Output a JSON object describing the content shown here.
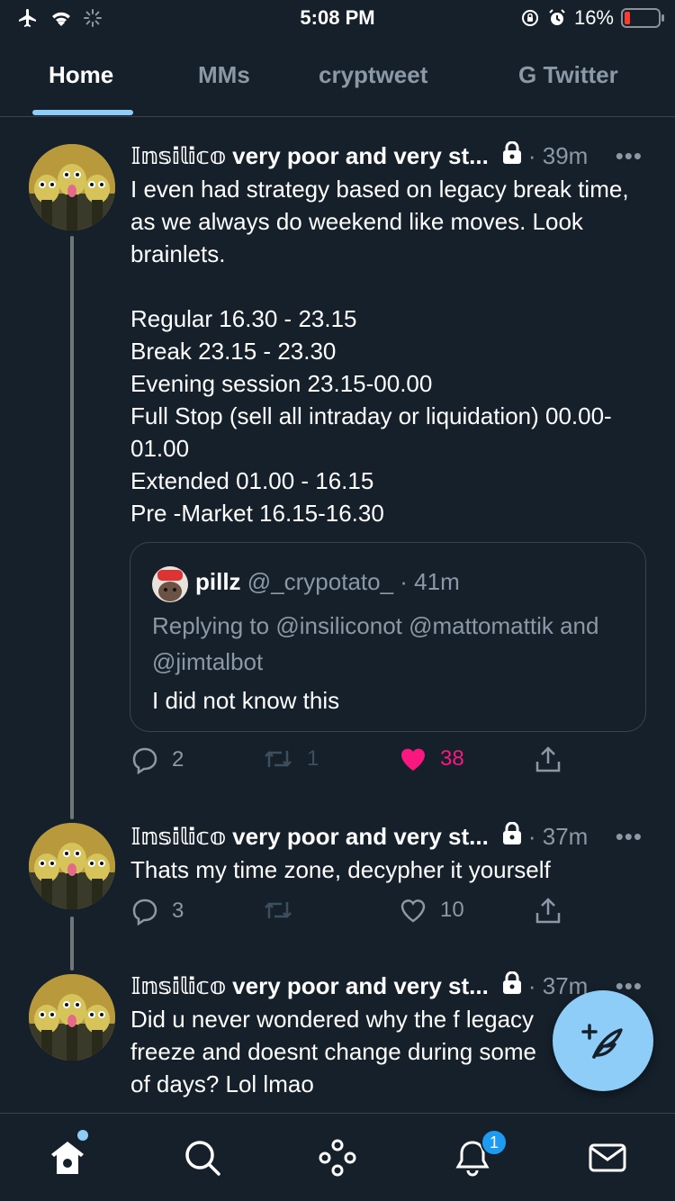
{
  "status_bar": {
    "time": "5:08 PM",
    "battery_text": "16%",
    "battery_level": 0.16,
    "battery_color": "#ff3b30"
  },
  "tabs": [
    {
      "label": "Home",
      "active": true
    },
    {
      "label": "MMs",
      "active": false
    },
    {
      "label": "cryptweet",
      "active": false
    },
    {
      "label": "G Twitter",
      "active": false
    }
  ],
  "tweets": [
    {
      "author": "𝕀𝕟𝕤𝕚𝕝𝕚𝕔𝕠 very poor and very st...",
      "time": "· 39m",
      "text": "I even had strategy based on legacy break time, as we always do weekend like moves. Look brainlets.\n\nRegular 16.30 - 23.15\nBreak 23.15 - 23.30\nEvening session 23.15-00.00\nFull Stop (sell all intraday or liquidation) 00.00-01.00\nExtended 01.00 - 16.15\nPre -Market 16.15-16.30",
      "quote": {
        "name": "pillz",
        "handle": "@_crypotato_",
        "time": "· 41m",
        "reply_prefix": "Replying to ",
        "reply_to": "@insiliconot @mattomattik and @jimtalbot",
        "text": "I did not know this"
      },
      "replies": "2",
      "retweets": "1",
      "likes": "38",
      "liked": true
    },
    {
      "author": "𝕀𝕟𝕤𝕚𝕝𝕚𝕔𝕠 very poor and very st...",
      "time": "· 37m",
      "text": "Thats my time zone, decypher it yourself",
      "replies": "3",
      "retweets": "",
      "likes": "10",
      "liked": false
    },
    {
      "author": "𝕀𝕟𝕤𝕚𝕝𝕚𝕔𝕠 very poor and very st...",
      "time": "· 37m",
      "text": "Did u never wondered why the f legacy\nfreeze and doesnt change during some\nof days? Lol lmao"
    }
  ],
  "notifications_badge": "1",
  "colors": {
    "background": "#15202b",
    "accent": "#8ecdf8",
    "secondary_text": "#8b98a5",
    "like": "#f91880",
    "border": "#38444d"
  },
  "icons": {
    "compose": "feather-plus-icon",
    "nav": [
      "home-icon",
      "search-icon",
      "spaces-icon",
      "notifications-bell-icon",
      "messages-envelope-icon"
    ]
  }
}
